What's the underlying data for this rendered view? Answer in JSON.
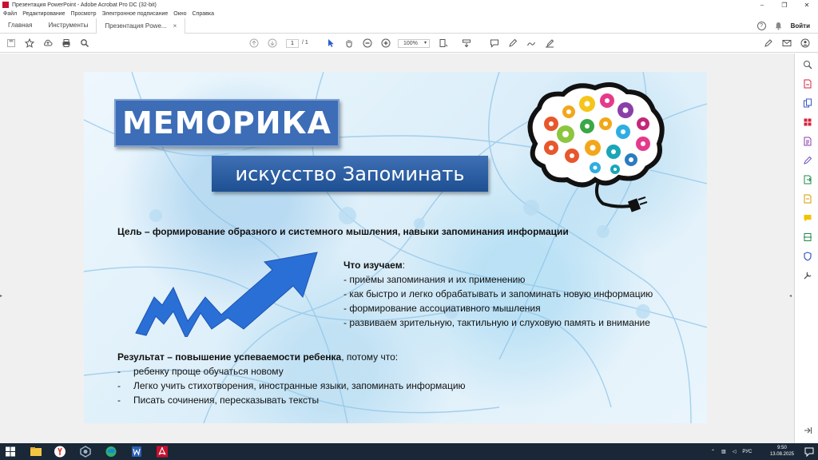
{
  "window": {
    "title": "Презентация PowerPoint - Adobe Acrobat Pro DC (32-bit)",
    "controls": [
      "–",
      "❐",
      "✕"
    ]
  },
  "menu": [
    "Файл",
    "Редактирование",
    "Просмотр",
    "Электронное подписание",
    "Окно",
    "Справка"
  ],
  "tabs": {
    "home": "Главная",
    "tools": "Инструменты",
    "document": "Презентация Powe...",
    "close": "×",
    "signin": "Войти",
    "help_icon": "?",
    "bell_icon": "bell-icon"
  },
  "toolbar": {
    "page_current": "1",
    "page_total": "/ 1",
    "zoom": "100%",
    "zoom_caret": "▾"
  },
  "slide": {
    "title": "МЕМОРИКА",
    "subtitle": "искусство Запоминать",
    "goal": "Цель – формирование образного и системного мышления, навыки запоминания информации",
    "study_head": "Что изучаем",
    "study_colon": ":",
    "study_items": [
      "- приёмы запоминания и их применению",
      "- как быстро и легко обрабатывать и запоминать новую информацию",
      "- формирование ассоциативного мышления",
      "- развиваем зрительную, тактильную и слуховую память и внимание"
    ],
    "result_head": "Результат – повышение успеваемости ребенка",
    "result_tail": ", потому что:",
    "result_dash": "-",
    "result_items": [
      "ребенку проще обучаться новому",
      "Легко учить стихотворения, иностранные языки, запоминать информацию",
      "Писать сочинения, пересказывать тексты"
    ]
  },
  "taskbar": {
    "lang": "РУС",
    "time": "9:50",
    "date": "13.08.2025"
  },
  "colors": {
    "title_bg": "#3c6db6",
    "subtitle_bg": "#1d4f92",
    "arrow": "#2a6fd6",
    "taskbar": "#1a2737",
    "acrobat_red": "#c8102e"
  }
}
